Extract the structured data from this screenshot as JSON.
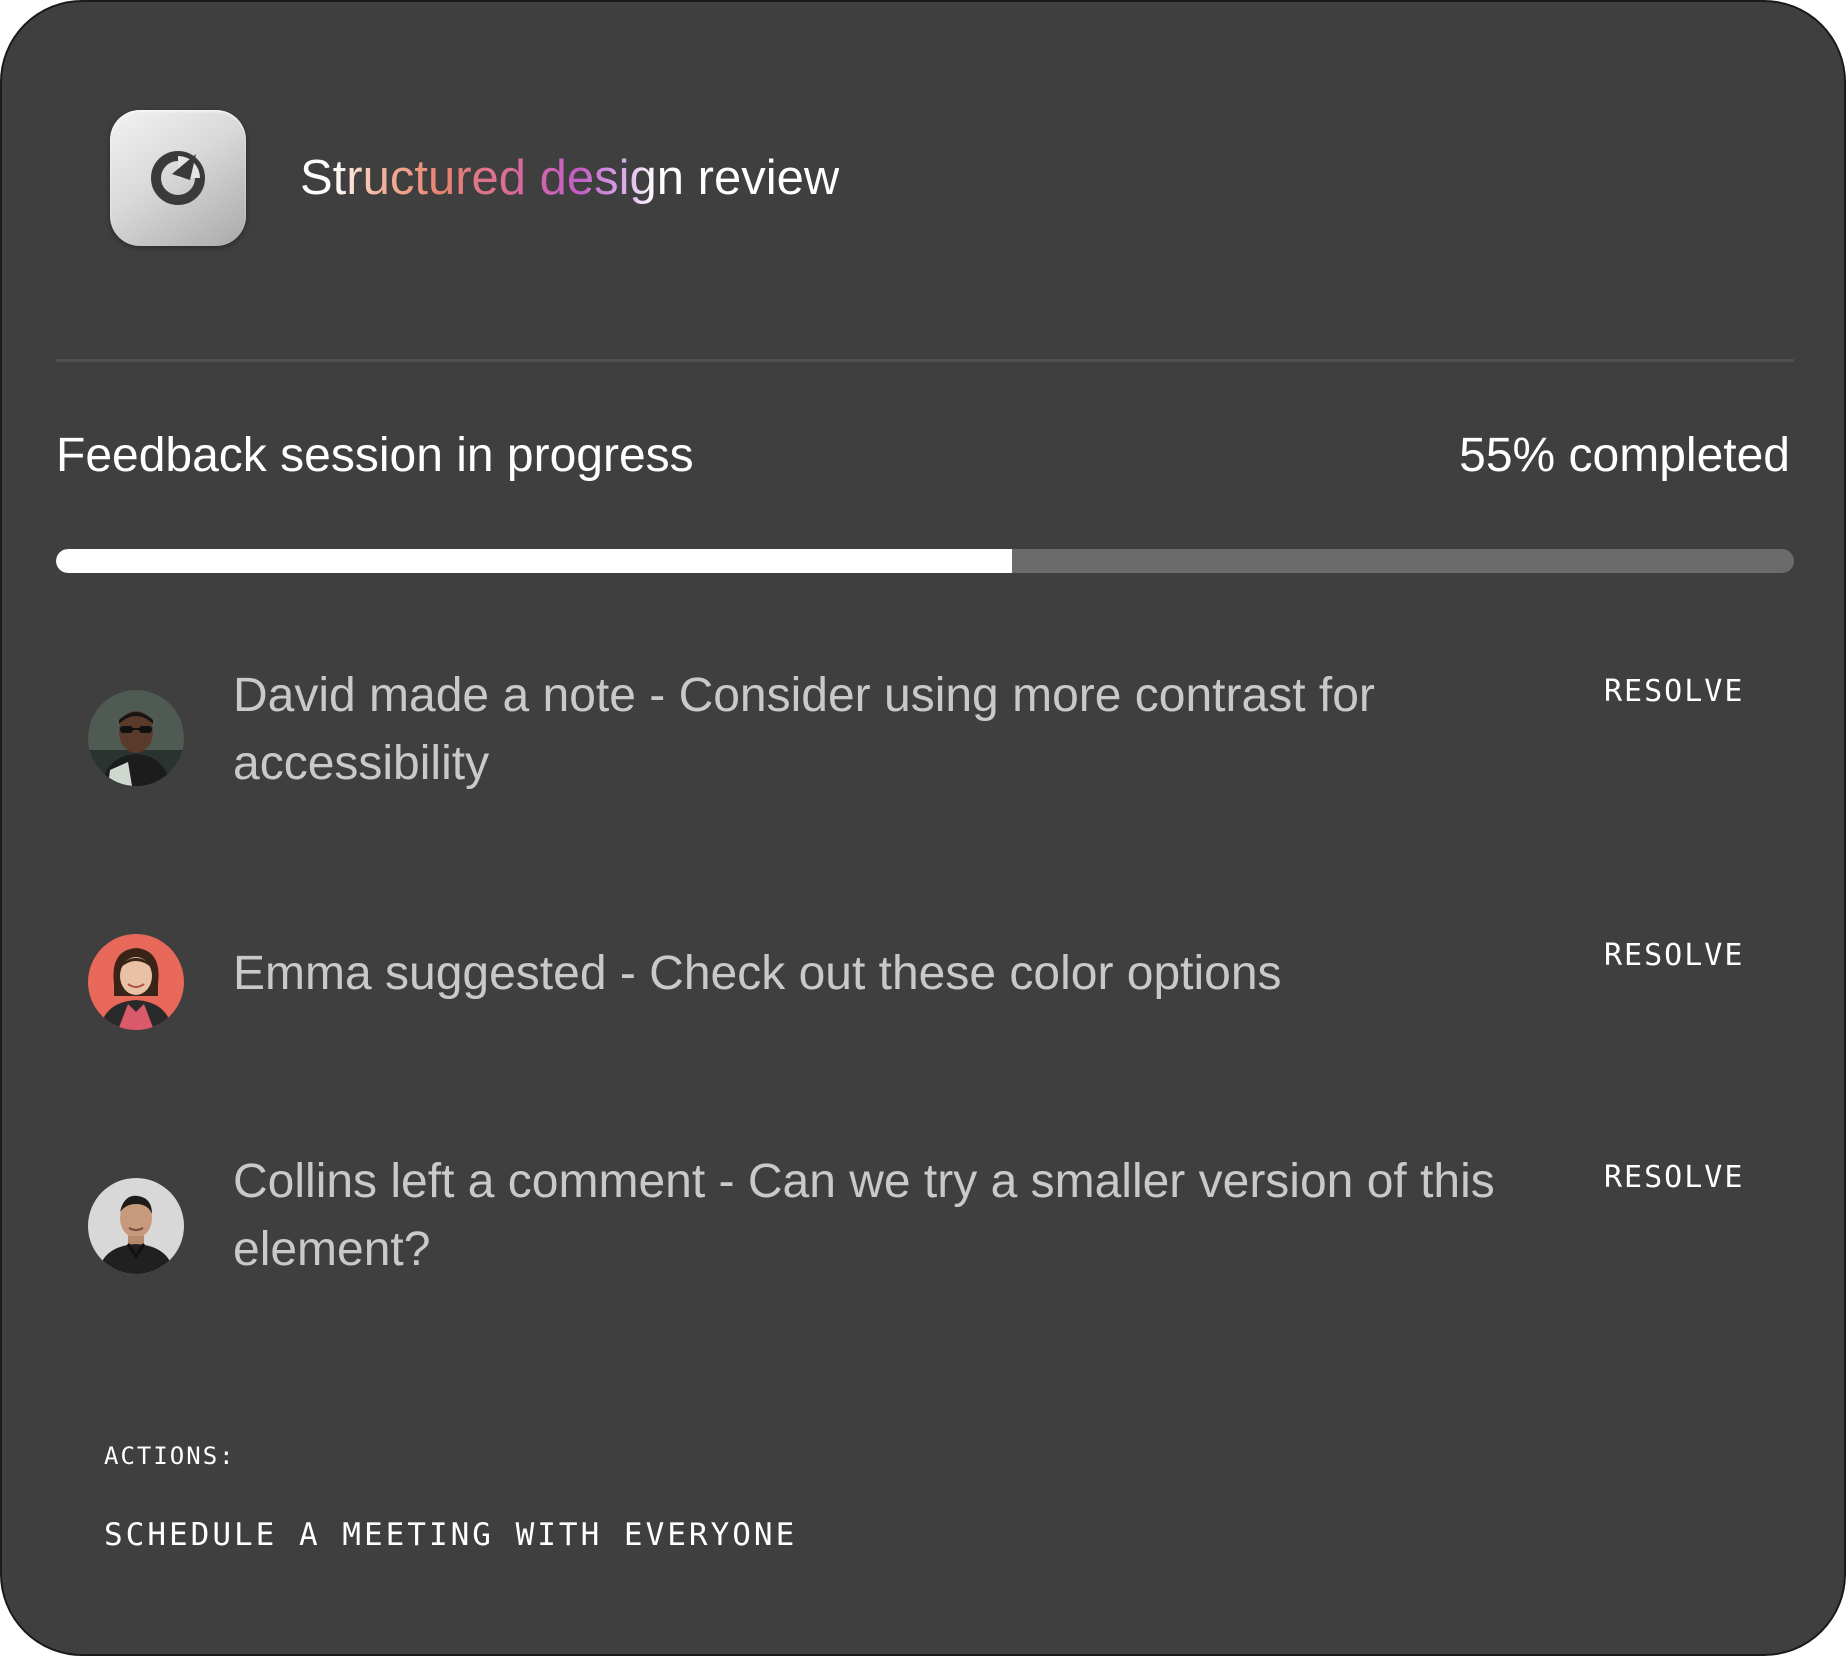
{
  "app": {
    "icon": "refresh-c-logo-icon",
    "title": "Structured design review"
  },
  "session": {
    "label": "Feedback session in progress",
    "progress_text": "55% completed",
    "progress_value": 0.55
  },
  "feedback": [
    {
      "author": "David",
      "avatar_icon": "avatar-david",
      "text": "David made a note - Consider using more contrast for accessibility",
      "action_label": "RESOLVE"
    },
    {
      "author": "Emma",
      "avatar_icon": "avatar-emma",
      "text": "Emma suggested - Check out these color options",
      "action_label": "RESOLVE"
    },
    {
      "author": "Collins",
      "avatar_icon": "avatar-collins",
      "text": "Collins left a comment - Can we try a smaller version of this element?",
      "action_label": "RESOLVE"
    }
  ],
  "actions": {
    "label": "ACTIONS:",
    "items": [
      "SCHEDULE A MEETING WITH EVERYONE"
    ]
  },
  "colors": {
    "card_background": "#3f3f3f",
    "progress_fill": "#ffffff",
    "progress_track": "#6b6b6b",
    "feedback_text": "#c9c9c9",
    "title_gradient": [
      "#ffffff",
      "#e8836f",
      "#c25ec8",
      "#ffffff"
    ]
  }
}
